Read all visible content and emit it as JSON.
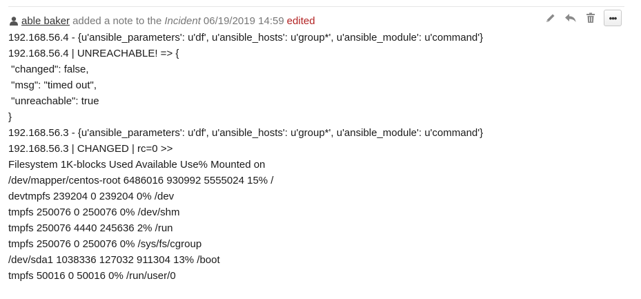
{
  "header": {
    "author": "able baker",
    "action_text": "added a note to the",
    "target": "Incident",
    "timestamp": "06/19/2019 14:59",
    "edited_label": "edited",
    "user_icon": "user-icon"
  },
  "actions": {
    "edit_icon": "pencil-icon",
    "reply_icon": "reply-icon",
    "delete_icon": "trash-icon",
    "more_label": "•••"
  },
  "note_lines": [
    "192.168.56.4 - {u'ansible_parameters': u'df', u'ansible_hosts': u'group*', u'ansible_module': u'command'}",
    "192.168.56.4 | UNREACHABLE! => {",
    " \"changed\": false,",
    " \"msg\": \"timed out\",",
    " \"unreachable\": true",
    "}",
    "192.168.56.3 - {u'ansible_parameters': u'df', u'ansible_hosts': u'group*', u'ansible_module': u'command'}",
    "192.168.56.3 | CHANGED | rc=0 >>",
    "Filesystem 1K-blocks Used Available Use% Mounted on",
    "/dev/mapper/centos-root 6486016 930992 5555024 15% /",
    "devtmpfs 239204 0 239204 0% /dev",
    "tmpfs 250076 0 250076 0% /dev/shm",
    "tmpfs 250076 4440 245636 2% /run",
    "tmpfs 250076 0 250076 0% /sys/fs/cgroup",
    "/dev/sda1 1038336 127032 911304 13% /boot",
    "tmpfs 50016 0 50016 0% /run/user/0"
  ],
  "colors": {
    "edited": "#b22222",
    "muted": "#777777",
    "icon": "#8a8a8a"
  }
}
